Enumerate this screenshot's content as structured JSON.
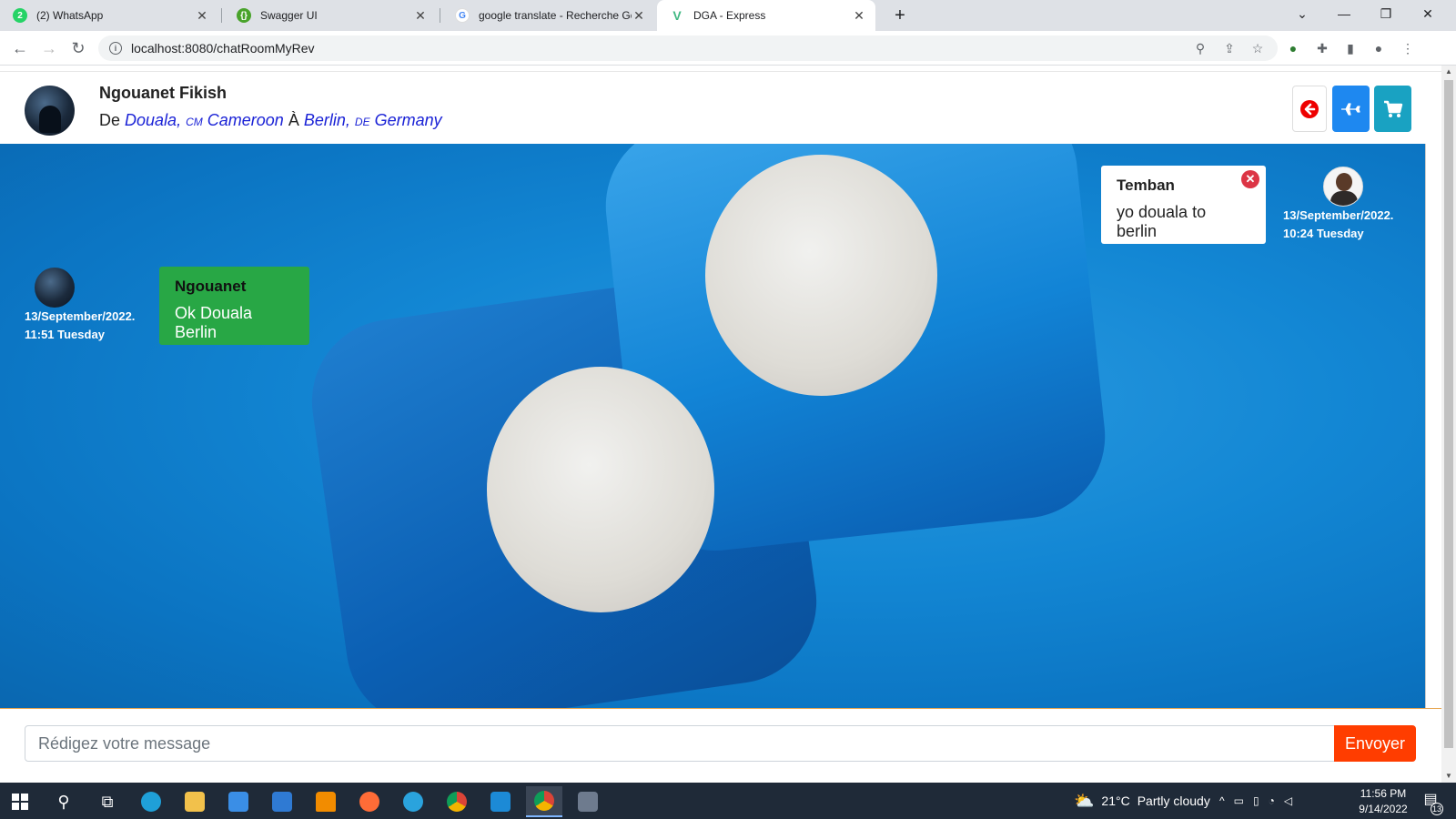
{
  "browser": {
    "tabs": [
      {
        "title": "(2) WhatsApp",
        "icon": "whatsapp-icon",
        "color": "#25d366"
      },
      {
        "title": "Swagger UI",
        "icon": "swagger-icon",
        "color": "#49a32b"
      },
      {
        "title": "google translate - Recherche Goo",
        "icon": "google-icon",
        "color": "#4285f4"
      },
      {
        "title": "DGA - Express",
        "icon": "vue-icon",
        "color": "#41b883"
      }
    ],
    "url": "localhost:8080/chatRoomMyRev"
  },
  "header": {
    "name": "Ngouanet Fikish",
    "de_label": "De",
    "from_city": "Douala,",
    "from_cc": "CM",
    "from_country": "Cameroon",
    "a_label": "À",
    "to_city": "Berlin,",
    "to_cc": "DE",
    "to_country": "Germany"
  },
  "messages": [
    {
      "side": "theirs",
      "sender": "Temban",
      "text": "yo douala to berlin",
      "date": "13/September/2022.",
      "time": "10:24 Tuesday"
    },
    {
      "side": "mine",
      "sender": "Ngouanet",
      "text": "Ok Douala Berlin",
      "date": "13/September/2022.",
      "time": "11:51 Tuesday"
    }
  ],
  "composer": {
    "placeholder": "Rédigez votre message",
    "send_label": "Envoyer"
  },
  "taskbar": {
    "weather_temp": "21°C",
    "weather_text": "Partly cloudy",
    "time": "11:56 PM",
    "date": "9/14/2022",
    "notif_count": "13"
  },
  "colors": {
    "send_button": "#ff3d00",
    "my_bubble": "#28a745",
    "plane_button": "#1e88f0",
    "cart_button": "#19a2c2"
  }
}
